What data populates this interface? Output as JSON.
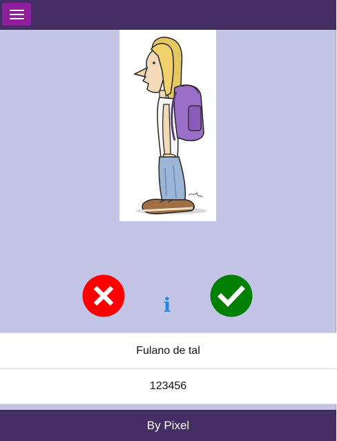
{
  "header": {
    "menu_icon": "hamburger-menu-icon",
    "background_color": "#452e63",
    "menu_button_color": "#8d1f9b"
  },
  "photo": {
    "subject": "cartoon student with backpack"
  },
  "actions": {
    "reject_icon": "x-circle-icon",
    "reject_color": "#ff0000",
    "info_text": "i",
    "info_color": "#1e88e5",
    "accept_icon": "check-circle-icon",
    "accept_color": "#008000"
  },
  "person": {
    "name": "Fulano de tal",
    "id": "123456"
  },
  "footer": {
    "text": "By Pixel"
  },
  "colors": {
    "page_background": "#c4c4e6"
  }
}
